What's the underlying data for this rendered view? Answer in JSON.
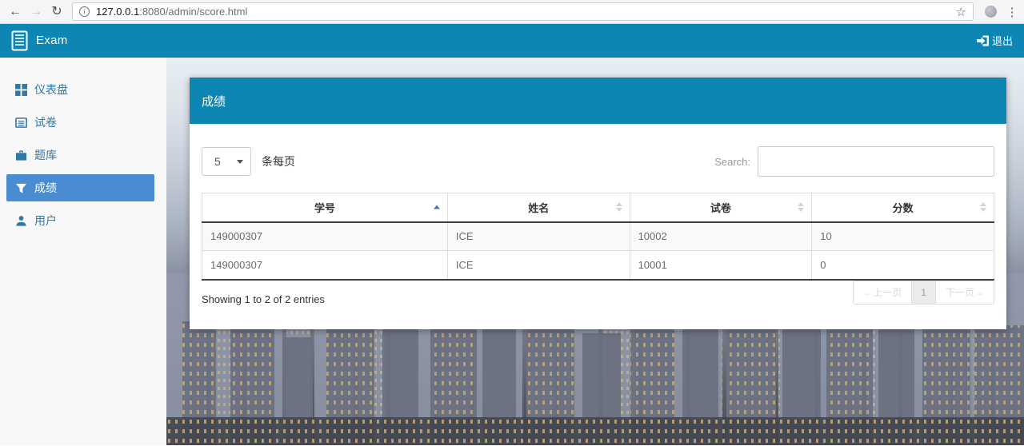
{
  "browser": {
    "back_icon": "←",
    "forward_icon": "→",
    "reload_icon": "↻",
    "info_icon": "i",
    "url_host": "127.0.0.1",
    "url_path": ":8080/admin/score.html",
    "star_icon": "☆",
    "menu_icon": "⋮"
  },
  "navbar": {
    "brand": "Exam",
    "logout_label": "退出"
  },
  "sidebar": {
    "items": [
      {
        "label": "仪表盘",
        "icon": "dashboard-icon",
        "active": false
      },
      {
        "label": "试卷",
        "icon": "papers-icon",
        "active": false
      },
      {
        "label": "题库",
        "icon": "question-bank-icon",
        "active": false
      },
      {
        "label": "成绩",
        "icon": "scores-filter-icon",
        "active": true
      },
      {
        "label": "用户",
        "icon": "users-icon",
        "active": false
      }
    ]
  },
  "panel": {
    "title": "成绩"
  },
  "controls": {
    "page_length_value": "5",
    "page_length_suffix": "条每页",
    "search_label": "Search:",
    "search_value": ""
  },
  "table": {
    "columns": [
      {
        "label": "学号",
        "sort": "asc"
      },
      {
        "label": "姓名",
        "sort": "none"
      },
      {
        "label": "试卷",
        "sort": "none"
      },
      {
        "label": "分数",
        "sort": "none"
      }
    ],
    "rows": [
      [
        "149000307",
        "ICE",
        "10002",
        "10"
      ],
      [
        "149000307",
        "ICE",
        "10001",
        "0"
      ]
    ]
  },
  "footer": {
    "info": "Showing 1 to 2 of 2 entries",
    "prev_label": "←上一页",
    "page": "1",
    "next_label": "下一页→"
  },
  "icons": {
    "brand": "notebook-lines-icon",
    "logout": "sign-out-icon",
    "page_length_caret": "chevron-down-icon",
    "sort_active": "sort-asc-icon",
    "sort_inactive": "sort-both-icon"
  },
  "colors": {
    "teal": "#0d86b3",
    "sidebar_link": "#2f79a9",
    "active_item": "#4a8cd2",
    "sort_active": "#3f76b4",
    "table_border": "#dddddd",
    "dark_rule": "#3f3f3f"
  }
}
